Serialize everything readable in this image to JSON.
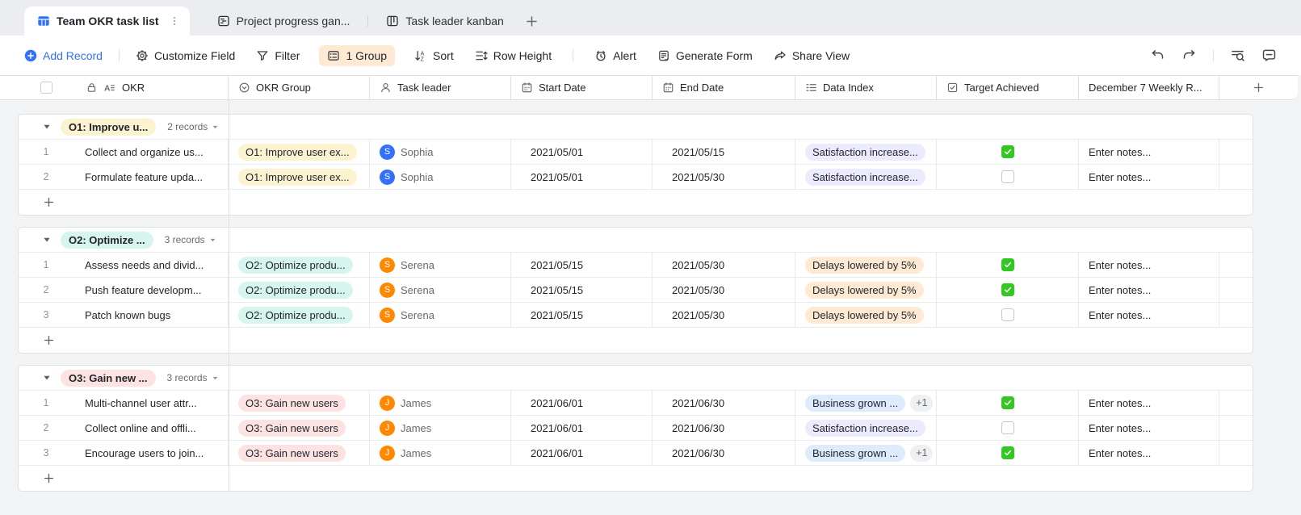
{
  "tab_bar": {
    "active_tab": {
      "label": "Team OKR task list",
      "icon": "grid-view",
      "more_icon": "more-vertical"
    },
    "tabs": [
      {
        "label": "Project progress gan...",
        "icon": "gantt-view"
      },
      {
        "label": "Task leader kanban",
        "icon": "kanban-view"
      }
    ],
    "add_icon": "plus"
  },
  "toolbar": {
    "add_record": {
      "label": "Add Record",
      "icon": "add-record"
    },
    "buttons": [
      {
        "label": "Customize Field",
        "icon": "gear"
      },
      {
        "label": "Filter",
        "icon": "filter"
      },
      {
        "label": "1 Group",
        "icon": "group",
        "active": true
      },
      {
        "label": "Sort",
        "icon": "sort"
      },
      {
        "label": "Row Height",
        "icon": "row-height"
      },
      {
        "label": "Alert",
        "icon": "alarm",
        "divider_before": true
      },
      {
        "label": "Generate Form",
        "icon": "form"
      },
      {
        "label": "Share View",
        "icon": "share"
      }
    ],
    "icon_buttons": [
      {
        "icon": "undo",
        "name": "undo-icon"
      },
      {
        "icon": "redo",
        "name": "redo-icon"
      },
      {
        "icon": "search-in-view",
        "name": "search-in-view-icon",
        "divider_before": true
      },
      {
        "icon": "collapse-comments",
        "name": "comment-panel-icon"
      }
    ]
  },
  "grid": {
    "header": {
      "columns": [
        {
          "id": "okr",
          "label": "OKR",
          "icons": [
            "lock",
            "text-field"
          ]
        },
        {
          "id": "okr_group",
          "label": "OKR Group",
          "icon": "single-select"
        },
        {
          "id": "task_leader",
          "label": "Task leader",
          "icon": "person"
        },
        {
          "id": "start_date",
          "label": "Start Date",
          "icon": "calendar"
        },
        {
          "id": "end_date",
          "label": "End Date",
          "icon": "calendar"
        },
        {
          "id": "data_index",
          "label": "Data Index",
          "icon": "checklist"
        },
        {
          "id": "target_achieved",
          "label": "Target Achieved",
          "icon": "checkbox-field"
        },
        {
          "id": "notes",
          "label": "December 7 Weekly R...",
          "icon": null
        },
        {
          "id": "add_field",
          "label": "",
          "icon": "plus"
        }
      ]
    },
    "groups": [
      {
        "label": "O1: Improve u...",
        "color": "yellow",
        "records_label": "2 records",
        "rows": [
          {
            "num": "1",
            "okr": "Collect and organize us...",
            "okr_group": {
              "text": "O1: Improve user ex...",
              "color": "yellow"
            },
            "leader": {
              "name": "Sophia",
              "initial": "S",
              "color": "#3370ff"
            },
            "start_date": "2021/05/01",
            "end_date": "2021/05/15",
            "data_index": [
              {
                "text": "Satisfaction increase...",
                "color": "purple"
              }
            ],
            "target_achieved": true,
            "notes_placeholder": "Enter notes..."
          },
          {
            "num": "2",
            "okr": "Formulate feature upda...",
            "okr_group": {
              "text": "O1: Improve user ex...",
              "color": "yellow"
            },
            "leader": {
              "name": "Sophia",
              "initial": "S",
              "color": "#3370ff"
            },
            "start_date": "2021/05/01",
            "end_date": "2021/05/30",
            "data_index": [
              {
                "text": "Satisfaction increase...",
                "color": "purple"
              }
            ],
            "target_achieved": false,
            "notes_placeholder": "Enter notes..."
          }
        ]
      },
      {
        "label": "O2: Optimize ...",
        "color": "teal",
        "records_label": "3 records",
        "rows": [
          {
            "num": "1",
            "okr": "Assess needs and divid...",
            "okr_group": {
              "text": "O2: Optimize produ...",
              "color": "teal"
            },
            "leader": {
              "name": "Serena",
              "initial": "S",
              "color": "#ff8800"
            },
            "start_date": "2021/05/15",
            "end_date": "2021/05/30",
            "data_index": [
              {
                "text": "Delays lowered by 5%",
                "color": "orange"
              }
            ],
            "target_achieved": true,
            "notes_placeholder": "Enter notes..."
          },
          {
            "num": "2",
            "okr": "Push feature developm...",
            "okr_group": {
              "text": "O2: Optimize produ...",
              "color": "teal"
            },
            "leader": {
              "name": "Serena",
              "initial": "S",
              "color": "#ff8800"
            },
            "start_date": "2021/05/15",
            "end_date": "2021/05/30",
            "data_index": [
              {
                "text": "Delays lowered by 5%",
                "color": "orange"
              }
            ],
            "target_achieved": true,
            "notes_placeholder": "Enter notes..."
          },
          {
            "num": "3",
            "okr": "Patch known bugs",
            "okr_group": {
              "text": "O2: Optimize produ...",
              "color": "teal"
            },
            "leader": {
              "name": "Serena",
              "initial": "S",
              "color": "#ff8800"
            },
            "start_date": "2021/05/15",
            "end_date": "2021/05/30",
            "data_index": [
              {
                "text": "Delays lowered by 5%",
                "color": "orange"
              }
            ],
            "target_achieved": false,
            "notes_placeholder": "Enter notes..."
          }
        ]
      },
      {
        "label": "O3: Gain new ...",
        "color": "red",
        "records_label": "3 records",
        "rows": [
          {
            "num": "1",
            "okr": "Multi-channel user attr...",
            "okr_group": {
              "text": "O3: Gain new users",
              "color": "red"
            },
            "leader": {
              "name": "James",
              "initial": "J",
              "color": "#ff8800"
            },
            "start_date": "2021/06/01",
            "end_date": "2021/06/30",
            "data_index": [
              {
                "text": "Business grown ...",
                "color": "blue"
              },
              {
                "text": "+1",
                "color": "overflow"
              }
            ],
            "target_achieved": true,
            "notes_placeholder": "Enter notes..."
          },
          {
            "num": "2",
            "okr": "Collect online and offli...",
            "okr_group": {
              "text": "O3: Gain new users",
              "color": "red"
            },
            "leader": {
              "name": "James",
              "initial": "J",
              "color": "#ff8800"
            },
            "start_date": "2021/06/01",
            "end_date": "2021/06/30",
            "data_index": [
              {
                "text": "Satisfaction increase...",
                "color": "purple"
              }
            ],
            "target_achieved": false,
            "notes_placeholder": "Enter notes..."
          },
          {
            "num": "3",
            "okr": "Encourage users to join...",
            "okr_group": {
              "text": "O3: Gain new users",
              "color": "red"
            },
            "leader": {
              "name": "James",
              "initial": "J",
              "color": "#ff8800"
            },
            "start_date": "2021/06/01",
            "end_date": "2021/06/30",
            "data_index": [
              {
                "text": "Business grown ...",
                "color": "blue"
              },
              {
                "text": "+1",
                "color": "overflow"
              }
            ],
            "target_achieved": true,
            "notes_placeholder": "Enter notes..."
          }
        ]
      }
    ]
  },
  "colors": {
    "yellow": "#fbf2cf",
    "teal": "#d7f5ef",
    "red": "#fde2e2",
    "purple": "#eceafd",
    "orange": "#feead2",
    "blue": "#ddebfd",
    "overflow": "#eff0f2",
    "accent_blue": "#3370ff",
    "avatar_orange": "#ff8800",
    "checkbox_green": "#34c724",
    "toolbar_highlight": "#feead2"
  }
}
